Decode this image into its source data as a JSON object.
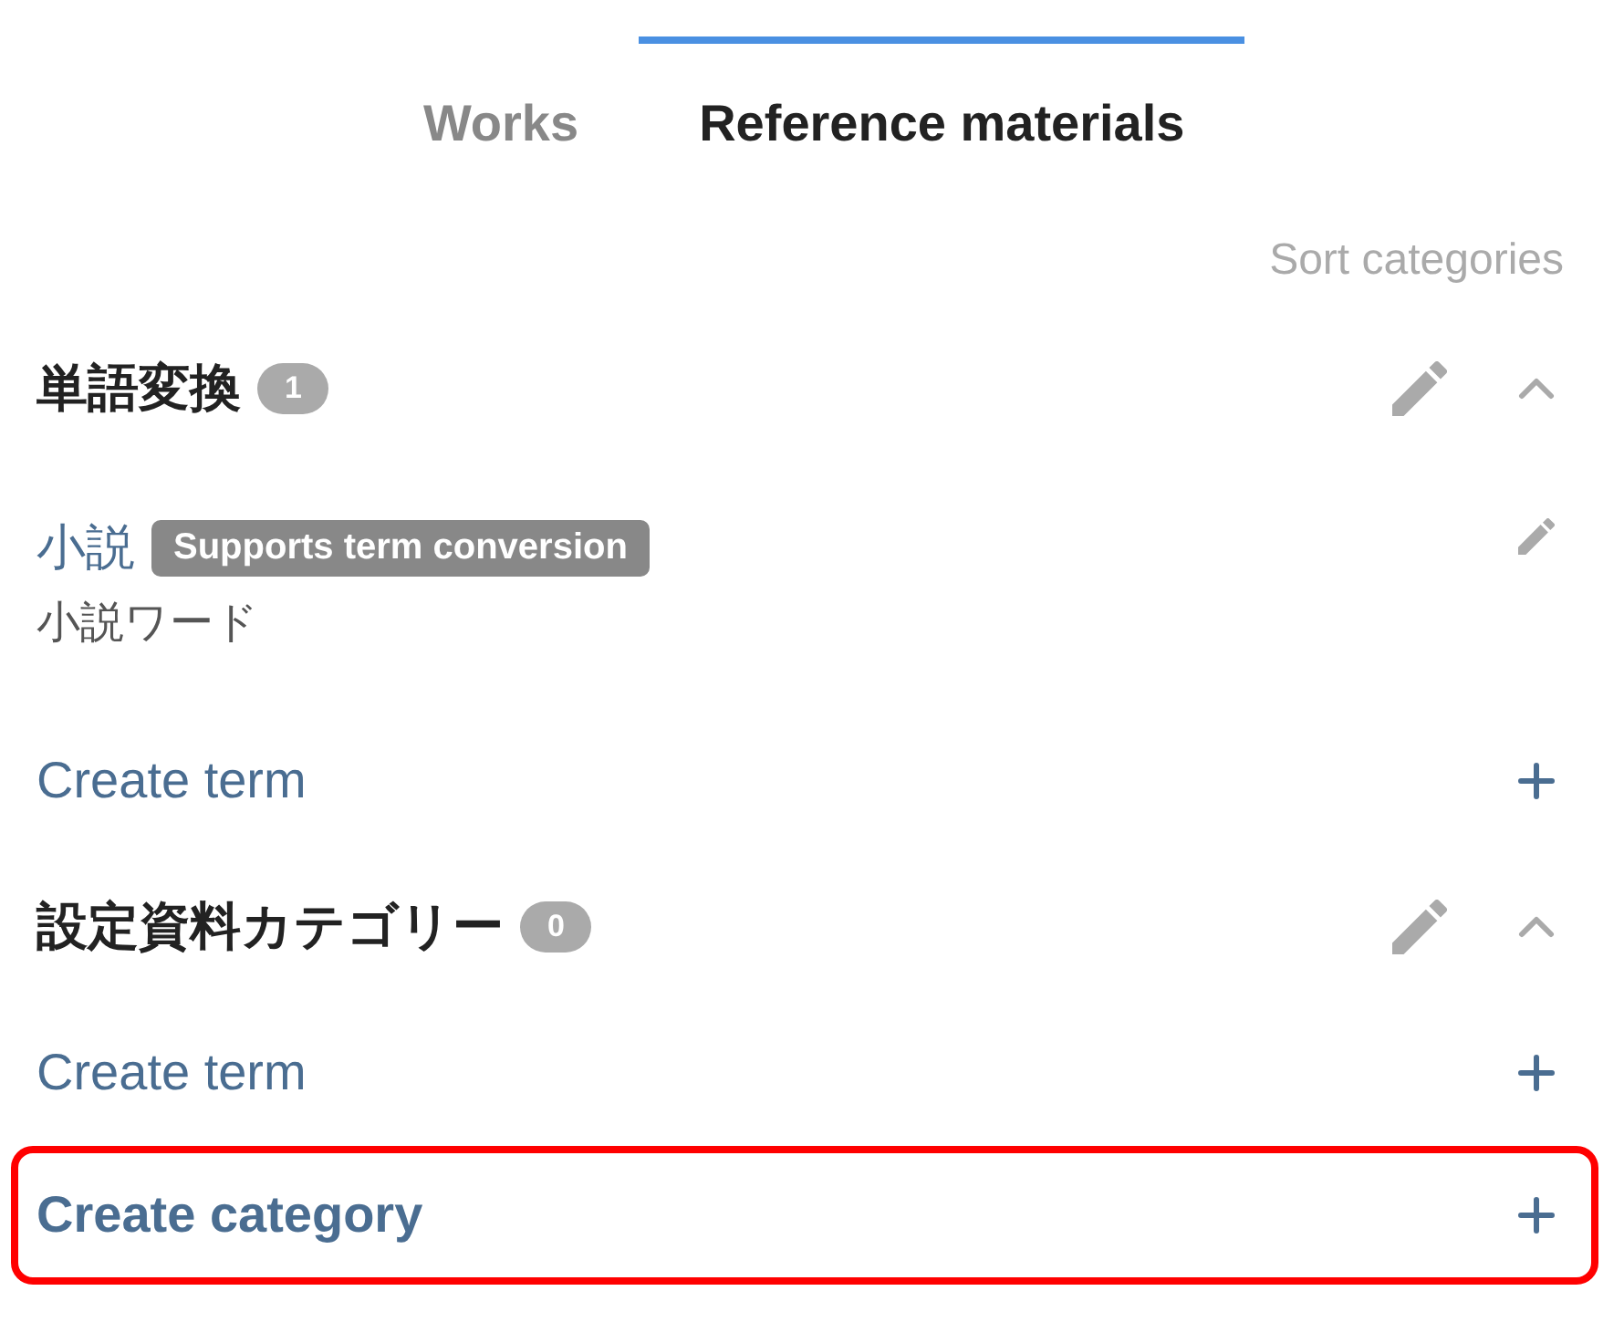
{
  "tabs": [
    {
      "label": "Works",
      "selected": false
    },
    {
      "label": "Reference materials",
      "selected": true
    }
  ],
  "sort_link": "Sort categories",
  "categories": [
    {
      "name": "単語変換",
      "count": "1",
      "expanded": true,
      "terms": [
        {
          "name": "小説",
          "tag": "Supports term conversion",
          "description": "小説ワード"
        }
      ],
      "create_term": "Create term"
    },
    {
      "name": "設定資料カテゴリー",
      "count": "0",
      "expanded": true,
      "create_term": "Create term"
    }
  ],
  "create_category": {
    "label": "Create category",
    "highlighted": true
  }
}
